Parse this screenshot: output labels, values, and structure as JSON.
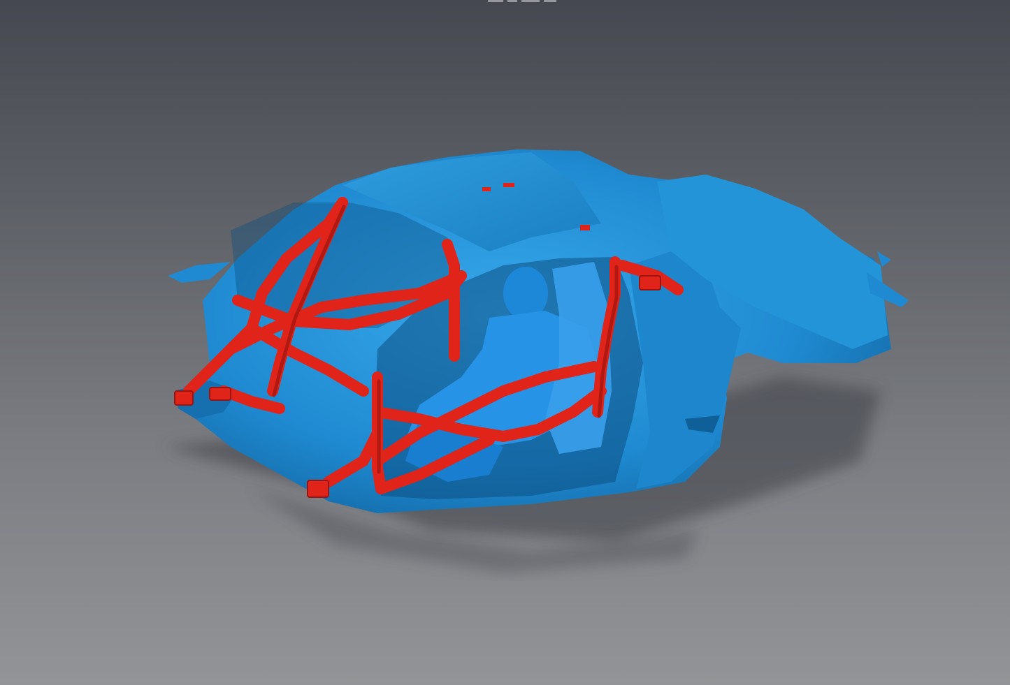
{
  "viewer": {
    "scene": "3d-scan-model",
    "colors": {
      "background_top": "#454850",
      "background_bottom": "#929497",
      "scan_surface": "#1f8ad1",
      "scan_surface_dark": "#0f5f98",
      "scan_surface_light": "#38a8ea",
      "rollcage": "#e02419",
      "rollcage_dark": "#9b1410",
      "shadow": "#3e4046"
    },
    "top_toolbar": {
      "icons": [
        "toolbar-tick-icon",
        "toolbar-tick-icon",
        "toolbar-tick-icon",
        "toolbar-tick-icon"
      ]
    }
  }
}
